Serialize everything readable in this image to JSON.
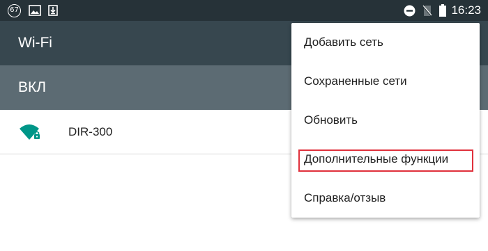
{
  "status_bar": {
    "notification_count": "67",
    "time": "16:23",
    "icons": [
      "notification-count-badge",
      "image-icon",
      "download-icon",
      "do-not-disturb-icon",
      "no-sim-icon",
      "battery-icon"
    ]
  },
  "toolbar": {
    "title": "Wi-Fi"
  },
  "switch_bar": {
    "label": "ВКЛ"
  },
  "networks": [
    {
      "ssid": "DIR-300",
      "icon": "wifi-locked-icon"
    }
  ],
  "menu": {
    "items": [
      {
        "label": "Добавить сеть"
      },
      {
        "label": "Сохраненные сети"
      },
      {
        "label": "Обновить"
      },
      {
        "label": "Дополнительные функции",
        "highlighted": true
      },
      {
        "label": "Справка/отзыв"
      }
    ]
  },
  "colors": {
    "status_bar": "#263238",
    "toolbar": "#37474f",
    "switch_bar": "#5c6b73",
    "accent": "#009688",
    "highlight": "#e0313c"
  }
}
